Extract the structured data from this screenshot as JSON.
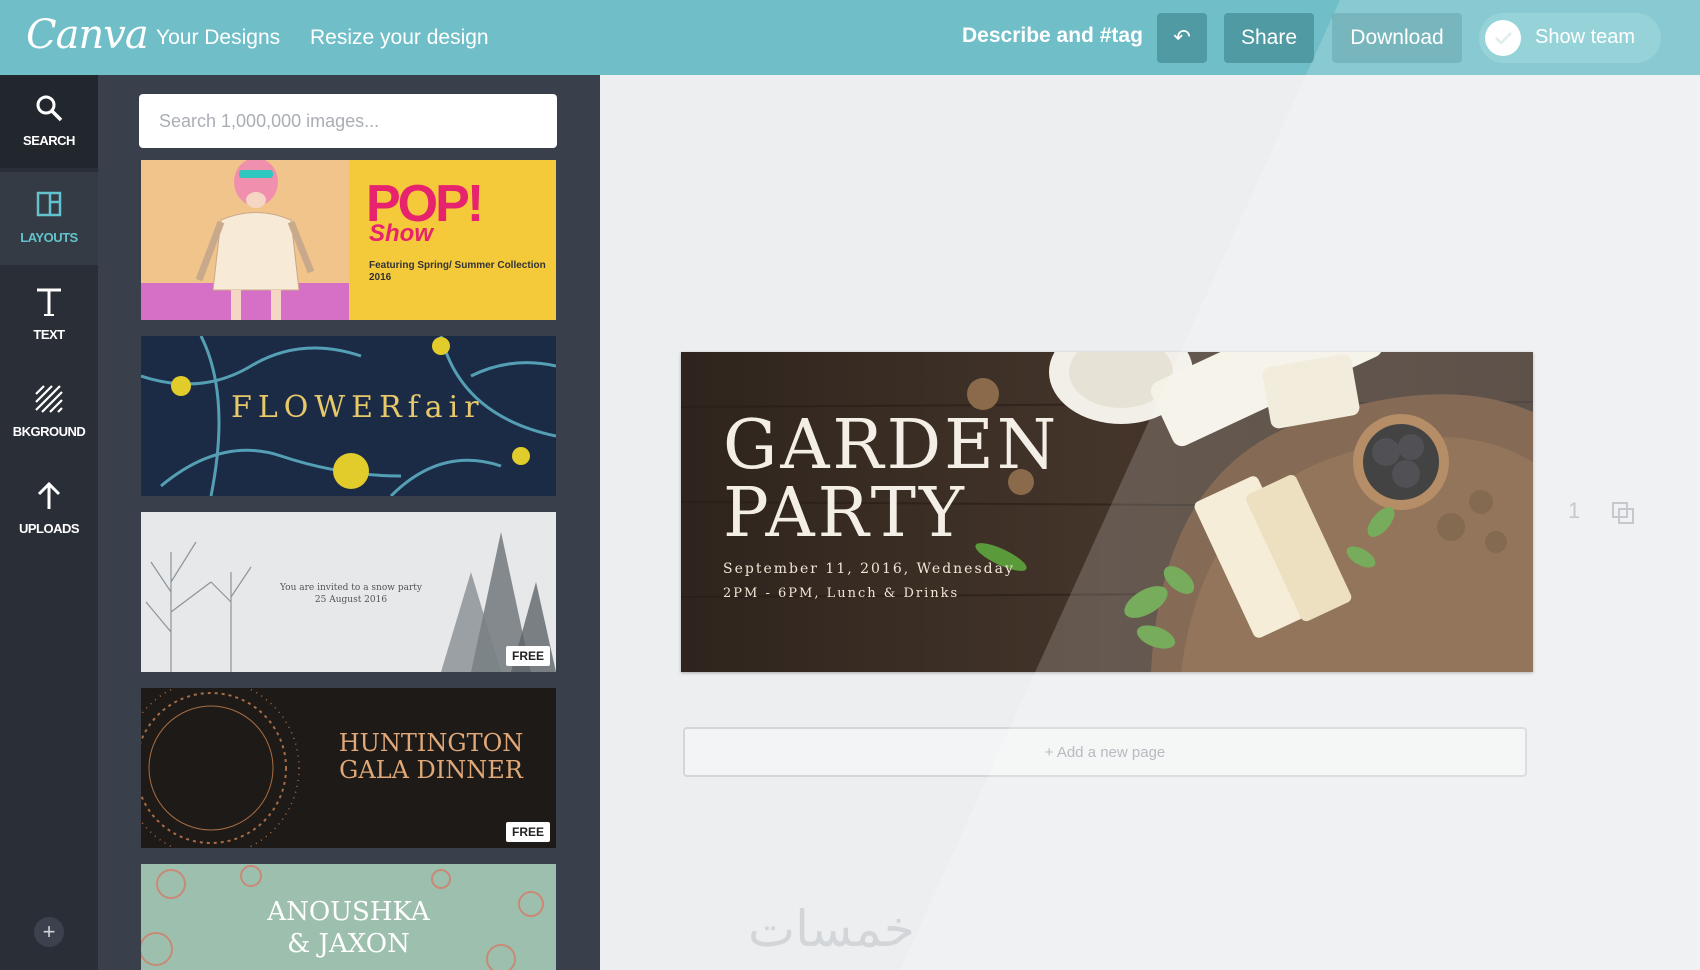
{
  "header": {
    "logo": "Canva",
    "nav": [
      "Your Designs",
      "Resize your design"
    ],
    "describe": "Describe and #tag",
    "undo_glyph": "↶",
    "share": "Share",
    "download": "Download",
    "show_team": "Show team"
  },
  "rail": {
    "items": [
      {
        "label": "SEARCH",
        "icon": "search-icon"
      },
      {
        "label": "LAYOUTS",
        "icon": "layouts-icon"
      },
      {
        "label": "TEXT",
        "icon": "text-icon"
      },
      {
        "label": "BKGROUND",
        "icon": "background-icon"
      },
      {
        "label": "UPLOADS",
        "icon": "upload-icon"
      }
    ],
    "add": "+"
  },
  "panel": {
    "search_placeholder": "Search 1,000,000 images...",
    "thumbs": {
      "pop": {
        "title": "POP!",
        "subtitle": "Show",
        "fine": "Featuring Spring/ Summer Collection 2016"
      },
      "flower": {
        "title": "FLOWERfair"
      },
      "winter": {
        "text": "You are invited to a snow party",
        "date": "25 August 2016",
        "badge": "FREE"
      },
      "gala": {
        "title_line1": "HUNTINGTON",
        "title_line2": "GALA DINNER",
        "badge": "FREE"
      },
      "wedding": {
        "line1": "ANOUSHKA",
        "line2": "& JAXON"
      }
    }
  },
  "canvas": {
    "design": {
      "title_line1": "GARDEN",
      "title_line2": "PARTY",
      "line1": "September 11, 2016, Wednesday",
      "line2": "2PM - 6PM, Lunch & Drinks"
    },
    "page_number": "1",
    "add_page": "+ Add a new page"
  },
  "watermark": "خمسات",
  "colors": {
    "header": "#70bfc8",
    "rail": "#2a2e36",
    "panel": "#3a404b",
    "accent": "#63c2cc"
  }
}
